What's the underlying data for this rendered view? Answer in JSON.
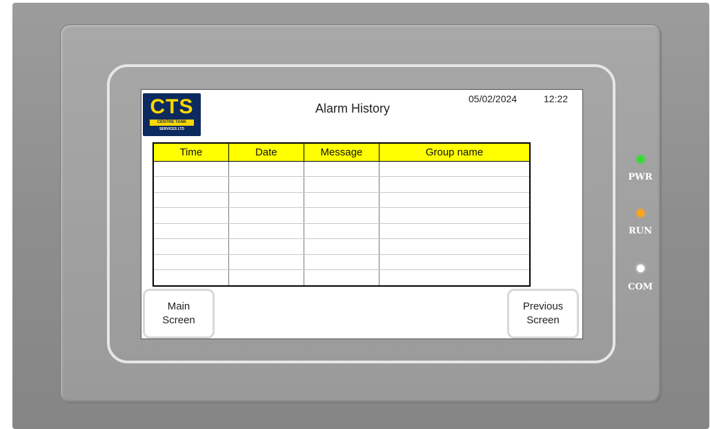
{
  "header": {
    "title": "Alarm History",
    "date": "05/02/2024",
    "time": "12:22"
  },
  "logo": {
    "letters": "CTS",
    "band_text": "CENTRE TANK",
    "sub_text": "SERVICES LTD",
    "colors": {
      "background": "#0d2a5e",
      "accent": "#ffd700"
    }
  },
  "table": {
    "columns": [
      "Time",
      "Date",
      "Message",
      "Group name"
    ],
    "rows": [
      [
        "",
        "",
        "",
        ""
      ],
      [
        "",
        "",
        "",
        ""
      ],
      [
        "",
        "",
        "",
        ""
      ],
      [
        "",
        "",
        "",
        ""
      ],
      [
        "",
        "",
        "",
        ""
      ],
      [
        "",
        "",
        "",
        ""
      ],
      [
        "",
        "",
        "",
        ""
      ],
      [
        "",
        "",
        "",
        ""
      ]
    ],
    "header_color": "#ffff00"
  },
  "buttons": {
    "main_screen": "Main\nScreen",
    "previous_screen": "Previous\nScreen"
  },
  "indicators": [
    {
      "label": "PWR",
      "color": "#33dd33",
      "icon": "led-green"
    },
    {
      "label": "RUN",
      "color": "#ffa51a",
      "icon": "led-orange"
    },
    {
      "label": "COM",
      "color": "#ffffff",
      "icon": "led-white"
    }
  ]
}
